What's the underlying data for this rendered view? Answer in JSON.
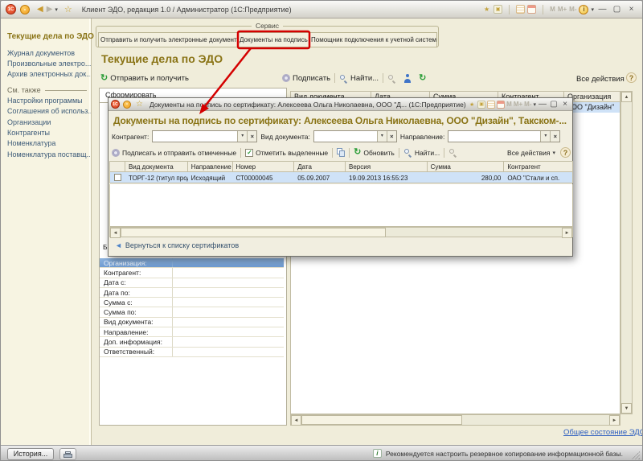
{
  "colors": {
    "accent_red": "#d40000",
    "heading_olive": "#8a7416",
    "link_blue": "#2e5fc0",
    "selection_blue": "#cfe2f7",
    "sidebar_link": "#3c5a78"
  },
  "icons": {
    "back": "◀",
    "forward": "▶",
    "caret_down": "▾",
    "star": "☆",
    "minimize": "—",
    "maximize": "▢",
    "close": "×",
    "scroll_up": "▲",
    "scroll_down": "▼",
    "scroll_left": "◄",
    "scroll_right": "►",
    "back_link_arrow": "◄",
    "memory": [
      "M",
      "M+",
      "M-"
    ],
    "help": "?",
    "info": "i",
    "window_icon": "▣"
  },
  "main_window": {
    "title": "Клиент ЭДО, редакция 1.0 / Администратор  (1С:Предприятие)",
    "sidebar": {
      "header": "Текущие дела по ЭДО",
      "items": [
        "Журнал документов",
        "Произвольные электро...",
        "Архив электронных док..."
      ],
      "see_also_label": "См. также",
      "see_also_items": [
        "Настройки программы",
        "Соглашения об использ...",
        "Организации",
        "Контрагенты",
        "Номенклатура",
        "Номенклатура поставщ..."
      ]
    },
    "service_panel": {
      "label": "Сервис",
      "tabs": [
        "Отправить и получить электронные документы",
        "Документы на подпись",
        "Помощник подключения к учетной системе"
      ]
    },
    "content": {
      "heading": "Текущие дела по ЭДО",
      "send_receive": "Отправить и получить",
      "sign": "Подписать",
      "find": "Найти...",
      "all_actions": "Все действия",
      "left_list_header": "Сформировать",
      "hidden_label_fragment": "Б",
      "filter_rows": [
        "Организация:",
        "Контрагент:",
        "Дата с:",
        "Дата по:",
        "Сумма с:",
        "Сумма по:",
        "Вид документа:",
        "Направление:",
        "Доп. информация:",
        "Ответственный:"
      ],
      "columns": [
        "Вид документа",
        "Дата",
        "Сумма",
        "Контрагент",
        "Организация"
      ],
      "selected_row_org": "ООО \"Дизайн\"",
      "footer_link": "Общее состояние ЭДО"
    },
    "status_bar": {
      "history": "История...",
      "message": "Рекомендуется настроить резервное копирование информационной базы."
    }
  },
  "dialog": {
    "title": "Документы на подпись по сертификату: Алексеева Ольга Николаевна, ООО \"Д... (1С:Предприятие)",
    "heading": "Документы на подпись по сертификату: Алексеева Ольга Николаевна, ООО \"Дизайн\", Такском-...",
    "filters": {
      "counterparty_label": "Контрагент:",
      "doc_type_label": "Вид документа:",
      "direction_label": "Направление:",
      "counterparty_value": "",
      "doc_type_value": "",
      "direction_value": ""
    },
    "toolbar": {
      "sign_send": "Подписать и отправить отмеченные",
      "mark_selected": "Отметить выделенные",
      "refresh": "Обновить",
      "find": "Найти...",
      "all_actions": "Все действия"
    },
    "table": {
      "columns": [
        "Вид документа",
        "Направление",
        "Номер",
        "Дата",
        "Версия",
        "Сумма",
        "Контрагент"
      ],
      "row": {
        "doc_type": "ТОРГ-12 (титул прод...",
        "direction": "Исходящий",
        "number": "СТ00000045",
        "date": "05.09.2007",
        "version": "19.09.2013 16:55:23",
        "sum": "280,00",
        "counterparty": "ОАО \"Стали и сп."
      }
    },
    "back_link": "Вернуться к списку сертификатов"
  }
}
